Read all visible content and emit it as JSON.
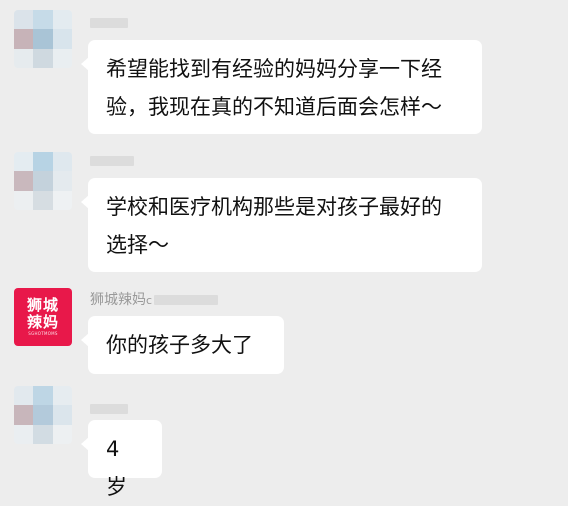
{
  "messages": [
    {
      "sender": "",
      "avatar_icon": "pixelated-avatar-icon",
      "text_lines": [
        "希望能找到有经验的妈妈分享一下经",
        "验，我现在真的不知道后面会怎样〜"
      ]
    },
    {
      "sender": "",
      "avatar_icon": "pixelated-avatar-icon",
      "text_lines": [
        "学校和医疗机构那些是对孩子最好的",
        "选择〜"
      ]
    },
    {
      "sender": "狮城辣妈",
      "sender_suffix": "c",
      "avatar_icon": "brand-logo-icon",
      "avatar_logo_line1": "狮城",
      "avatar_logo_line2": "辣妈",
      "avatar_logo_small": "SGHOTMOMS",
      "text_lines": [
        "你的孩子多大了"
      ]
    },
    {
      "sender": "",
      "avatar_icon": "pixelated-avatar-icon",
      "text_lines": [
        "4 岁"
      ]
    }
  ],
  "colors": {
    "background": "#ededed",
    "bubble": "#ffffff",
    "brand": "#e8184a"
  }
}
